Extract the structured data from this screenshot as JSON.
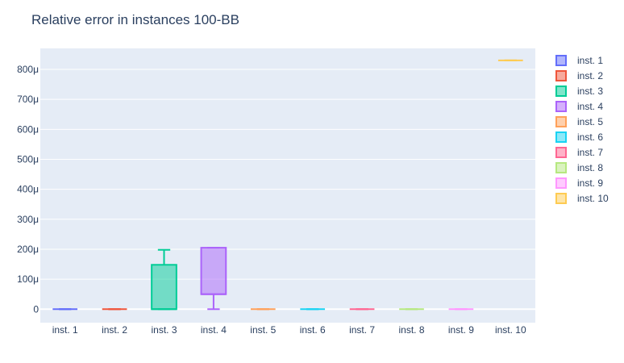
{
  "chart_data": {
    "type": "box",
    "title": "Relative error in instances 100-BB",
    "xlabel": "",
    "ylabel": "",
    "ylim": [
      -45,
      870
    ],
    "yticks": [
      0,
      100,
      200,
      300,
      400,
      500,
      600,
      700,
      800
    ],
    "ytick_labels": [
      "0",
      "100μ",
      "200μ",
      "300μ",
      "400μ",
      "500μ",
      "600μ",
      "700μ",
      "800μ"
    ],
    "y_unit": "μ",
    "grid": true,
    "legend_position": "right",
    "categories": [
      "inst. 1",
      "inst. 2",
      "inst. 3",
      "inst. 4",
      "inst. 5",
      "inst. 6",
      "inst. 7",
      "inst. 8",
      "inst. 9",
      "inst. 10"
    ],
    "series": [
      {
        "name": "inst. 1",
        "color": "#636efa",
        "min": 0,
        "q1": 0,
        "median": 0,
        "q3": 0,
        "max": 0
      },
      {
        "name": "inst. 2",
        "color": "#ef553b",
        "min": 0,
        "q1": 0,
        "median": 0,
        "q3": 0,
        "max": 0
      },
      {
        "name": "inst. 3",
        "color": "#00cc96",
        "min": 0,
        "q1": 0,
        "median": 0,
        "q3": 148,
        "max": 198
      },
      {
        "name": "inst. 4",
        "color": "#ab63fa",
        "min": 0,
        "q1": 50,
        "median": 50,
        "q3": 205,
        "max": 205
      },
      {
        "name": "inst. 5",
        "color": "#ffa15a",
        "min": 0,
        "q1": 0,
        "median": 0,
        "q3": 0,
        "max": 0
      },
      {
        "name": "inst. 6",
        "color": "#19d3f3",
        "min": 0,
        "q1": 0,
        "median": 0,
        "q3": 0,
        "max": 0
      },
      {
        "name": "inst. 7",
        "color": "#ff6692",
        "min": 0,
        "q1": 0,
        "median": 0,
        "q3": 0,
        "max": 0
      },
      {
        "name": "inst. 8",
        "color": "#b6e880",
        "min": 0,
        "q1": 0,
        "median": 0,
        "q3": 0,
        "max": 0
      },
      {
        "name": "inst. 9",
        "color": "#ff97ff",
        "min": 0,
        "q1": 0,
        "median": 0,
        "q3": 0,
        "max": 0
      },
      {
        "name": "inst. 10",
        "color": "#fecb52",
        "min": 830,
        "q1": 830,
        "median": 830,
        "q3": 830,
        "max": 830
      }
    ]
  }
}
